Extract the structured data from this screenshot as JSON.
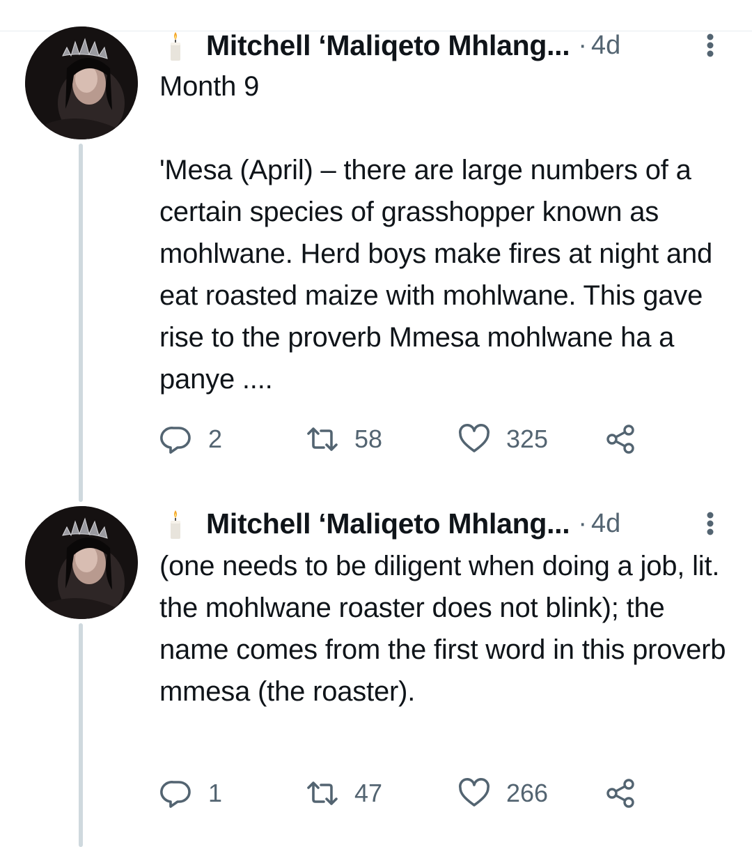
{
  "tweets": [
    {
      "author": "Mitchell ‘Maliqeto Mhlang...",
      "separator": "·",
      "time": "4d",
      "text": "Month 9\n\n'Mesa (April) – there are large numbers of a certain species of grasshopper known as mohlwane. Herd boys make fires at night and eat roasted maize with mohlwane. This gave rise to the proverb Mmesa mohlwane ha a panye ....",
      "replies": "2",
      "retweets": "58",
      "likes": "325"
    },
    {
      "author": "Mitchell ‘Maliqeto Mhlang...",
      "separator": "·",
      "time": "4d",
      "text": "(one needs to be diligent when doing a job, lit. the mohlwane roaster does not blink); the name comes from the first word in this proverb mmesa (the roaster).",
      "replies": "1",
      "retweets": "47",
      "likes": "266"
    }
  ],
  "icons": {
    "name_emoji": "candle-icon",
    "more": "more-vertical-icon",
    "reply": "reply-icon",
    "retweet": "retweet-icon",
    "like": "heart-icon",
    "share": "share-icon"
  },
  "colors": {
    "text": "#0f1419",
    "secondary": "#536471",
    "thread_line": "#cfd9de",
    "divider": "#e6ecf0"
  }
}
